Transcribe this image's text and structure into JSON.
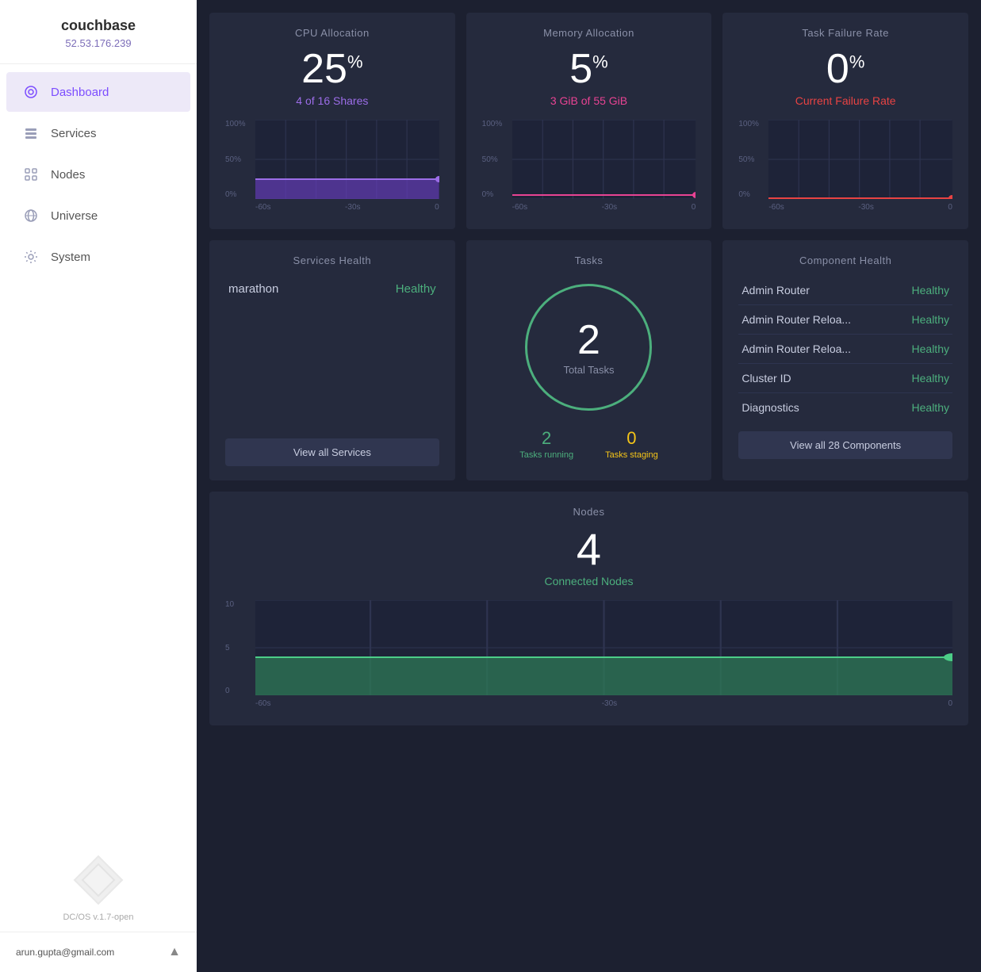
{
  "sidebar": {
    "app_name": "couchbase",
    "ip": "52.53.176.239",
    "nav_items": [
      {
        "id": "dashboard",
        "label": "Dashboard",
        "active": true
      },
      {
        "id": "services",
        "label": "Services",
        "active": false
      },
      {
        "id": "nodes",
        "label": "Nodes",
        "active": false
      },
      {
        "id": "universe",
        "label": "Universe",
        "active": false
      },
      {
        "id": "system",
        "label": "System",
        "active": false
      }
    ],
    "version": "DC/OS v.1.7-open",
    "user_email": "arun.gupta@gmail.com"
  },
  "cpu": {
    "title": "CPU Allocation",
    "value": "25",
    "unit": "%",
    "subtitle": "4 of 16 Shares",
    "y_labels": [
      "100%",
      "50%",
      "0%"
    ],
    "x_labels": [
      "-60s",
      "-30s",
      "0"
    ]
  },
  "memory": {
    "title": "Memory Allocation",
    "value": "5",
    "unit": "%",
    "subtitle": "3 GiB of 55 GiB",
    "y_labels": [
      "100%",
      "50%",
      "0%"
    ],
    "x_labels": [
      "-60s",
      "-30s",
      "0"
    ]
  },
  "failure": {
    "title": "Task Failure Rate",
    "value": "0",
    "unit": "%",
    "subtitle": "Current Failure Rate",
    "y_labels": [
      "100%",
      "50%",
      "0%"
    ],
    "x_labels": [
      "-60s",
      "-30s",
      "0"
    ]
  },
  "services_health": {
    "title": "Services Health",
    "items": [
      {
        "name": "marathon",
        "status": "Healthy",
        "color": "green"
      }
    ],
    "view_btn": "View all Services"
  },
  "tasks": {
    "title": "Tasks",
    "total": "2",
    "total_label": "Total Tasks",
    "running_count": "2",
    "running_label": "Tasks running",
    "staging_count": "0",
    "staging_label": "Tasks staging"
  },
  "component_health": {
    "title": "Component Health",
    "items": [
      {
        "name": "Admin Router",
        "status": "Healthy",
        "color": "green"
      },
      {
        "name": "Admin Router Reloa...",
        "status": "Healthy",
        "color": "green"
      },
      {
        "name": "Admin Router Reloa...",
        "status": "Healthy",
        "color": "green"
      },
      {
        "name": "Cluster ID",
        "status": "Healthy",
        "color": "green"
      },
      {
        "name": "Diagnostics",
        "status": "Healthy",
        "color": "green"
      }
    ],
    "view_btn": "View all 28 Components"
  },
  "nodes": {
    "title": "Nodes",
    "count": "4",
    "label": "Connected Nodes",
    "y_labels": [
      "10",
      "5",
      "0"
    ],
    "x_labels": [
      "-60s",
      "-30s",
      "0"
    ]
  }
}
